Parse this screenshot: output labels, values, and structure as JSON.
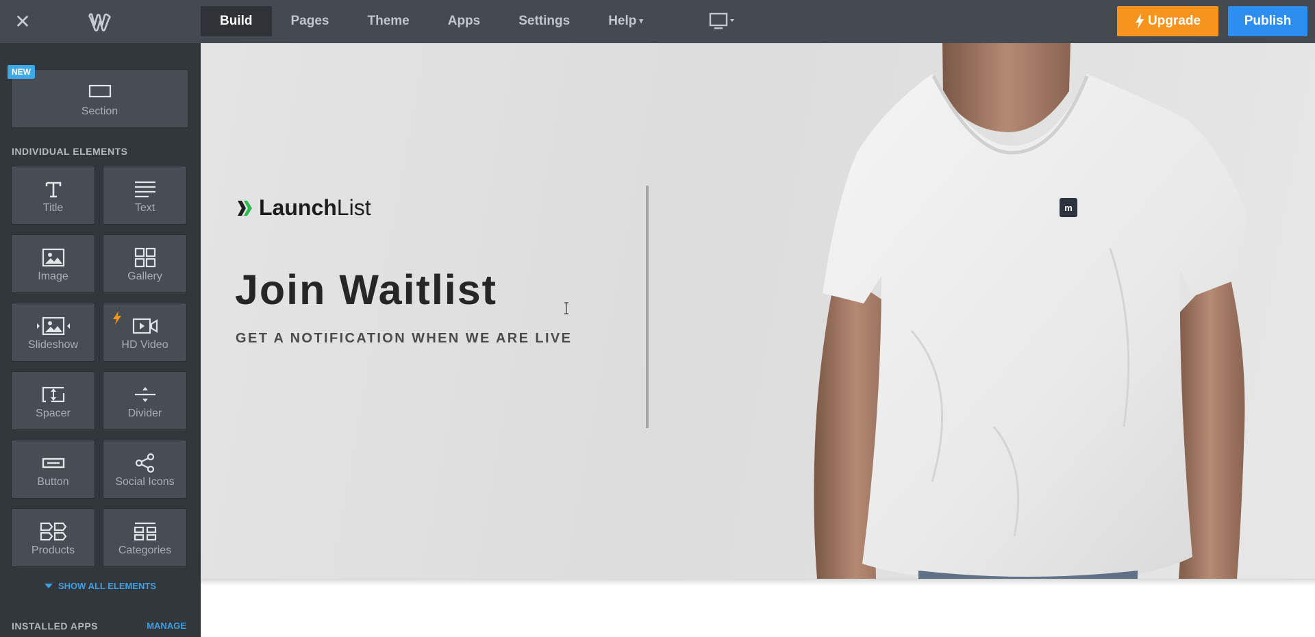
{
  "topbar": {
    "nav": [
      {
        "label": "Build",
        "active": true
      },
      {
        "label": "Pages",
        "active": false
      },
      {
        "label": "Theme",
        "active": false
      },
      {
        "label": "Apps",
        "active": false
      },
      {
        "label": "Settings",
        "active": false
      },
      {
        "label": "Help",
        "active": false,
        "caret": "▾"
      }
    ],
    "upgrade_label": "Upgrade",
    "publish_label": "Publish",
    "colors": {
      "upgrade": "#f7941d",
      "publish": "#2d8ef0",
      "bar": "#454a50"
    }
  },
  "sidebar": {
    "new_badge": "NEW",
    "section_tile": {
      "label": "Section",
      "icon": "section-icon"
    },
    "individual_heading": "INDIVIDUAL ELEMENTS",
    "elements": [
      {
        "label": "Title",
        "icon": "title-icon"
      },
      {
        "label": "Text",
        "icon": "text-icon"
      },
      {
        "label": "Image",
        "icon": "image-icon"
      },
      {
        "label": "Gallery",
        "icon": "gallery-icon"
      },
      {
        "label": "Slideshow",
        "icon": "slideshow-icon"
      },
      {
        "label": "HD Video",
        "icon": "hd-video-icon",
        "premium": true
      },
      {
        "label": "Spacer",
        "icon": "spacer-icon"
      },
      {
        "label": "Divider",
        "icon": "divider-icon"
      },
      {
        "label": "Button",
        "icon": "button-icon"
      },
      {
        "label": "Social Icons",
        "icon": "social-icons-icon"
      },
      {
        "label": "Products",
        "icon": "products-icon"
      },
      {
        "label": "Categories",
        "icon": "categories-icon"
      }
    ],
    "show_all": "SHOW ALL ELEMENTS",
    "installed_apps_heading": "INSTALLED APPS",
    "manage_label": "MANAGE"
  },
  "canvas": {
    "brand_bold": "Launch",
    "brand_regular": "List",
    "title": "Join Waitlist",
    "subtitle": "GET A NOTIFICATION WHEN WE ARE LIVE"
  }
}
